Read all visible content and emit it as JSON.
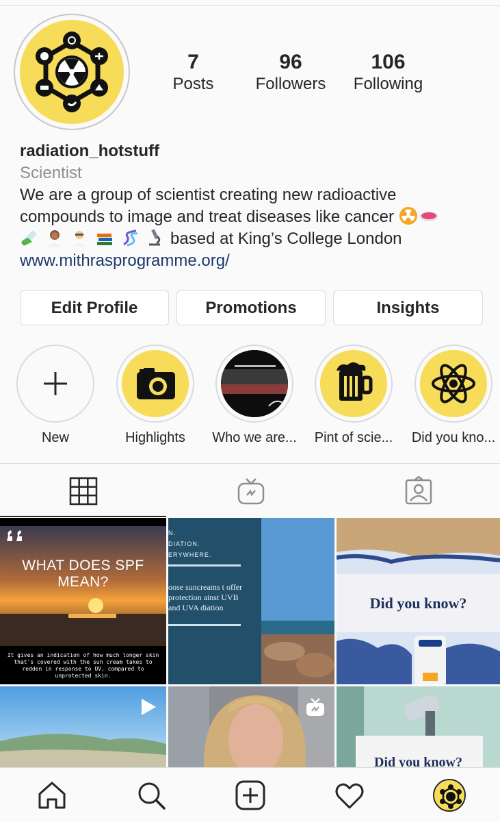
{
  "profile": {
    "username": "radiation_hotstuff",
    "category": "Scientist",
    "bio_line1": "We are a group of scientist creating new radioactive",
    "bio_line2": "compounds to image and treat diseases like cancer",
    "bio_line3": "based at King’s College London",
    "website": "www.mithrasprogramme.org/"
  },
  "stats": {
    "posts": "7",
    "posts_label": "Posts",
    "followers": "96",
    "followers_label": "Followers",
    "following": "106",
    "following_label": "Following"
  },
  "buttons": {
    "edit_profile": "Edit Profile",
    "promotions": "Promotions",
    "insights": "Insights"
  },
  "highlights": [
    {
      "label": "New",
      "icon": "plus-icon"
    },
    {
      "label": "Highlights",
      "icon": "camera-icon"
    },
    {
      "label": "Who we are...",
      "icon": "video-thumbnail"
    },
    {
      "label": "Pint of scie...",
      "icon": "beer-icon"
    },
    {
      "label": "Did you kno...",
      "icon": "atom-icon"
    }
  ],
  "tabs": [
    {
      "icon": "grid-icon",
      "active": true
    },
    {
      "icon": "igtv-icon",
      "active": false
    },
    {
      "icon": "tagged-icon",
      "active": false
    }
  ],
  "posts": {
    "p1_title": "WHAT DOES SPF MEAN?",
    "p1_caption": "It gives an indication of how much longer skin that's covered with the sun cream takes to redden in response to UV, compared to unprotected skin.",
    "p2_line1": "N.",
    "p2_line2": "DIATION.",
    "p2_line3": "ERYWHERE.",
    "p2_body": "oose suncreams t offer protection ainst UVB and UVA diation",
    "p3_title": "Did you know?",
    "p6_title": "Did you know?"
  },
  "bottom_nav": [
    {
      "icon": "home-icon"
    },
    {
      "icon": "search-icon"
    },
    {
      "icon": "add-post-icon"
    },
    {
      "icon": "heart-icon"
    },
    {
      "icon": "profile-avatar-icon"
    }
  ],
  "colors": {
    "brand_yellow": "#f6dc58",
    "link_blue": "#1c3a6b",
    "muted_gray": "#8e8e8e"
  }
}
